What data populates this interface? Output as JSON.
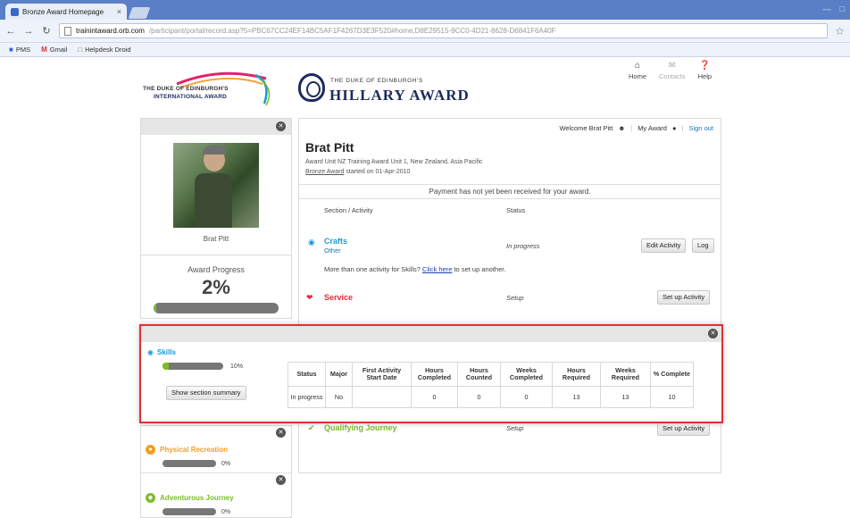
{
  "browser": {
    "tab_title": "Bronze Award Homepage",
    "tab_close": "×",
    "url_host": "trainintaward.orb.com",
    "url_path": "/participant/portal/record.asp?5=PBC67CC24EF14BC5AF1F4267D3E3F520#home,D8E29515-9CC0-4D21-8628-D6841F6A40F",
    "bookmarks": [
      {
        "icon": "tinyicon",
        "label": "PMS"
      },
      {
        "icon": "gmail-icon",
        "label": "Gmail"
      },
      {
        "icon": "doc-icon",
        "label": "Helpdesk Droid"
      }
    ]
  },
  "header": {
    "intl_logo_line1": "THE DUKE OF EDINBURGH'S",
    "intl_logo_line2": "INTERNATIONAL AWARD",
    "hillary_small": "THE DUKE OF EDINBURGH'S",
    "hillary_big": "HILLARY AWARD",
    "nav": [
      {
        "icon": "home-icon",
        "label": "Home"
      },
      {
        "icon": "contacts-icon",
        "label": "Contacts"
      },
      {
        "icon": "help-icon",
        "label": "Help"
      }
    ]
  },
  "userbar": {
    "welcome": "Welcome Brat Pitt",
    "my_award": "My Award",
    "sign_out": "Sign out"
  },
  "profile": {
    "name": "Brat Pitt",
    "caption": "Brat Pitt",
    "progress_title": "Award Progress",
    "progress_value": "2%",
    "progress_fraction": 0.02
  },
  "award": {
    "unit_line": "Award Unit NZ Training Award Unit 1, New Zealand, Asia Pacific",
    "start_link": "Bronze Award",
    "start_rest": " started on 01-Apr-2010",
    "payment": "Payment has not yet been received for your award.",
    "col_section": "Section / Activity",
    "col_status": "Status"
  },
  "activities": {
    "crafts_title": "Crafts",
    "crafts_sub": "Other",
    "crafts_status": "In progress",
    "edit_label": "Edit Activity",
    "log_label": "Log",
    "more_pre": "More than one activity for Skills? ",
    "more_link": "Click here",
    "more_post": " to set up another.",
    "service_title": "Service",
    "service_status": "Setup",
    "setup_label": "Set up Activity",
    "journey_title": "Qualifying Journey",
    "journey_status": "Setup",
    "journey_setup_label": "Set up Activity"
  },
  "sections": {
    "physical_title": "Physical Recreation",
    "physical_pct": "0%",
    "physical_fraction": 0,
    "adventurous_title": "Adventurous Journey",
    "adventurous_pct": "0%",
    "adventurous_fraction": 0
  },
  "skills": {
    "title": "Skills",
    "pct": "10%",
    "fraction": 0.1,
    "summary_button": "Show section summary",
    "headers": [
      "Status",
      "Major",
      "First Activity Start Date",
      "Hours Completed",
      "Hours Counted",
      "Weeks Completed",
      "Hours Required",
      "Weeks Required",
      "% Complete"
    ],
    "row": [
      "In progress",
      "No",
      "",
      "0",
      "0",
      "0",
      "13",
      "13",
      "10"
    ]
  },
  "colors": {
    "accent_red": "#e03034",
    "skills_blue": "#1a9ad6",
    "service_red": "#e02c3c",
    "physical_orange": "#f0a020",
    "adventurous_green": "#7cbc2a",
    "progress_green": "#7cbc2a"
  }
}
